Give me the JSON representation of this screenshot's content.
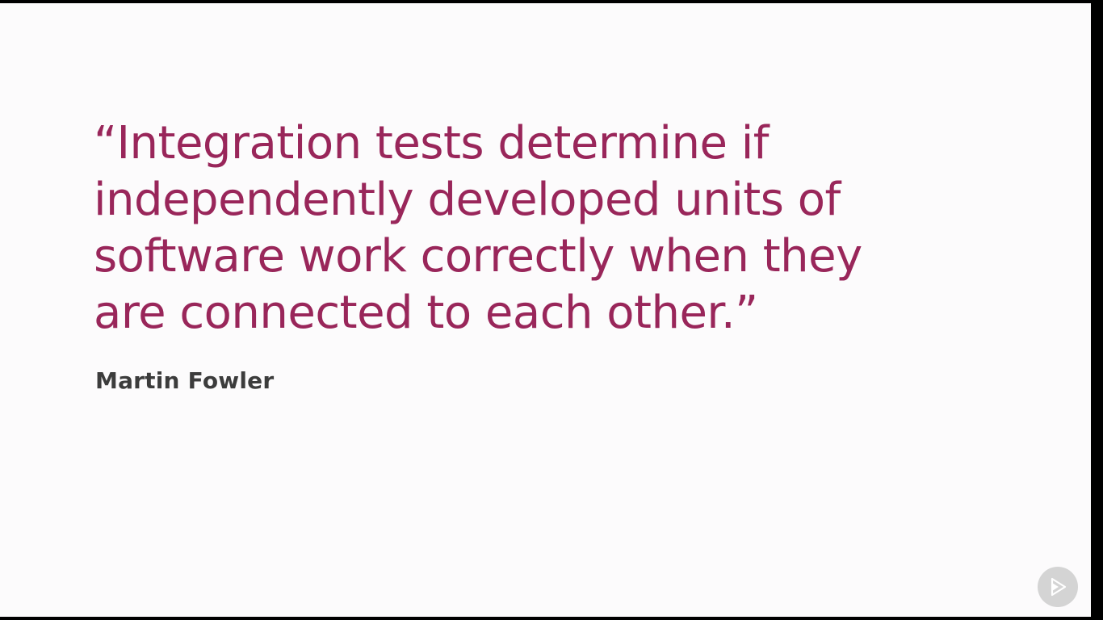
{
  "slide": {
    "quote_lines": [
      "“Integration tests determine if",
      "independently developed units of",
      "software work correctly when they",
      "are connected to each other.”"
    ],
    "author": "Martin Fowler"
  },
  "player": {
    "play_icon": "play-logo-icon"
  },
  "colors": {
    "quote": "#99265a",
    "author": "#3c3c3c",
    "background": "#fcfbfc"
  }
}
